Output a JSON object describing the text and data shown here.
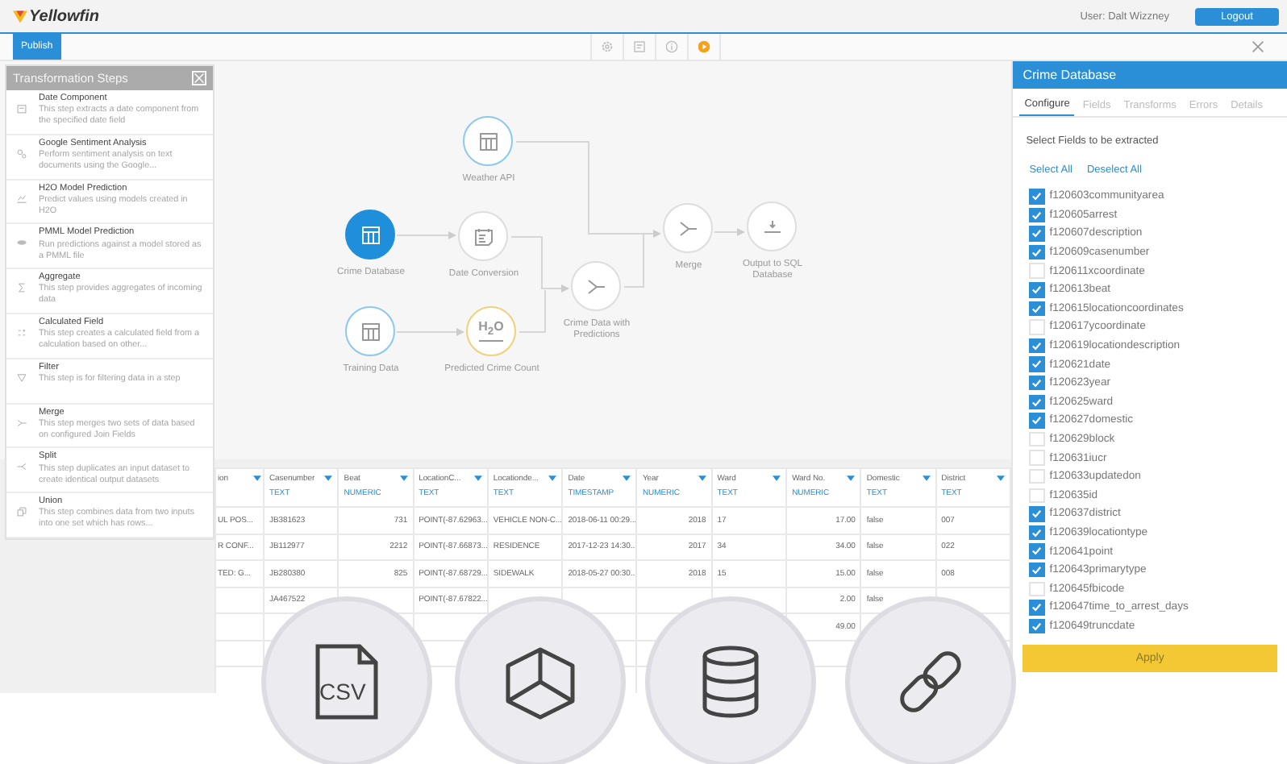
{
  "header": {
    "logo": "Yellowfin",
    "user": "User: Dalt Wizzney",
    "logout": "Logout"
  },
  "toolbar": {
    "tabs": [
      {
        "label": "Publish",
        "selected": true
      }
    ],
    "tools": [
      {
        "kind": "gear"
      },
      {
        "kind": "form"
      },
      {
        "kind": "info"
      },
      {
        "kind": "play"
      }
    ]
  },
  "steps_panel": {
    "title": "Transformation Steps",
    "items": [
      {
        "kind": "date",
        "title": "Date Component",
        "description": "This step extracts a date component from the specified date field"
      },
      {
        "kind": "sentiment",
        "title": "Google Sentiment Analysis",
        "description": "Perform sentiment analysis on text documents using the Google..."
      },
      {
        "kind": "model",
        "title": "H2O Model Prediction",
        "description": "Predict values using models created in H2O"
      },
      {
        "kind": "pmml",
        "title": "PMML Model Prediction",
        "description": "Run predictions against a model stored as a PMML file"
      },
      {
        "kind": "sum",
        "title": "Aggregate",
        "description": "This step provides aggregates of incoming data"
      },
      {
        "kind": "calc",
        "title": "Calculated Field",
        "description": "This step creates a calculated field from a calculation based on other..."
      },
      {
        "kind": "filter",
        "title": "Filter",
        "description": "This step is for filtering data in a step"
      },
      {
        "kind": "merge",
        "title": "Merge",
        "description": "This step merges two sets of data based on configured Join Fields"
      },
      {
        "kind": "split",
        "title": "Split",
        "description": "This step duplicates an input dataset to create identical output datasets"
      },
      {
        "kind": "union",
        "title": "Union",
        "description": "This step combines data from two inputs into one set which has rows..."
      }
    ]
  },
  "diagram": {
    "nodes": [
      {
        "kind": "table",
        "label": "Weather API",
        "color": "#8cc8ee",
        "selected": false
      },
      {
        "kind": "table",
        "label": "Crime Database",
        "color": "#1f8fdc",
        "selected": true
      },
      {
        "kind": "calendar",
        "label": "Date Conversion",
        "color": "#dddddd",
        "selected": false
      },
      {
        "kind": "table",
        "label": "Training Data",
        "color": "#8cc8ee",
        "selected": false
      },
      {
        "kind": "h2o",
        "icon_text": "H$_{2}$O",
        "label": "Predicted Crime Count",
        "color": "#f2cf7a",
        "selected": false
      },
      {
        "kind": "merge",
        "label": "Crime Data with Predictions",
        "color": "#dddddd",
        "selected": false
      },
      {
        "kind": "merge",
        "label": "Merge",
        "color": "#dddddd",
        "selected": false
      },
      {
        "kind": "output",
        "label": "Output to SQL Database",
        "color": "#dddddd",
        "selected": false
      }
    ]
  },
  "table": {
    "columns": [
      {
        "name": "ion"
      },
      {
        "name": "Casenumber",
        "type": "TEXT"
      },
      {
        "name": "Beat",
        "type": "NUMERIC"
      },
      {
        "name": "LocationC...",
        "type": "TEXT"
      },
      {
        "name": "Locationde...",
        "type": "TEXT"
      },
      {
        "name": "Date",
        "type": "TIMESTAMP"
      },
      {
        "name": "Year",
        "type": "NUMERIC"
      },
      {
        "name": "Ward",
        "type": "TEXT"
      },
      {
        "name": "Ward No.",
        "type": "NUMERIC"
      },
      {
        "name": "Domestic",
        "type": "TEXT"
      },
      {
        "name": "District",
        "type": "TEXT"
      }
    ],
    "rows": [
      [
        "UL POS...",
        "JB381623",
        "731",
        "POINT(-87.62963...",
        "VEHICLE NON-C...",
        "2018-06-11 00:29...",
        "2018",
        "17",
        "17.00",
        "false",
        "007"
      ],
      [
        "R CONF...",
        "JB112977",
        "2212",
        "POINT(-87.66873...",
        "RESIDENCE",
        "2017-12-23 14:30...",
        "2017",
        "34",
        "34.00",
        "false",
        "022"
      ],
      [
        "TED: G...",
        "JB280380",
        "825",
        "POINT(-87.68729...",
        "SIDEWALK",
        "2018-05-27 00:30...",
        "2018",
        "15",
        "15.00",
        "false",
        "008"
      ],
      [
        null,
        "JA467522",
        null,
        "POINT(-87.67822...",
        null,
        null,
        null,
        null,
        "2.00",
        "false",
        null
      ],
      [
        null,
        null,
        null,
        null,
        null,
        null,
        null,
        null,
        "49.00",
        null,
        null
      ],
      [
        null,
        null,
        null,
        null,
        null,
        null,
        null,
        null,
        null,
        null,
        null
      ],
      [
        null,
        null,
        null,
        null,
        null,
        null,
        null,
        null,
        null,
        null,
        null
      ]
    ]
  },
  "fields_panel": {
    "title": "Crime Database",
    "tabs": [
      {
        "label": "Configure",
        "selected": true
      },
      {
        "label": "Fields",
        "selected": false
      },
      {
        "label": "Transforms",
        "selected": false
      },
      {
        "label": "Errors",
        "selected": false
      },
      {
        "label": "Details",
        "selected": false
      }
    ],
    "instruction": "Select Fields to be extracted",
    "select_all": "Select All",
    "deselect_all": "Deselect All",
    "fields": [
      {
        "name": "f120603communityarea",
        "checked": true
      },
      {
        "name": "f120605arrest",
        "checked": true
      },
      {
        "name": "f120607description",
        "checked": true
      },
      {
        "name": "f120609casenumber",
        "checked": true
      },
      {
        "name": "f120611xcoordinate",
        "checked": false
      },
      {
        "name": "f120613beat",
        "checked": true
      },
      {
        "name": "f120615locationcoordinates",
        "checked": true
      },
      {
        "name": "f120617ycoordinate",
        "checked": false
      },
      {
        "name": "f120619locationdescription",
        "checked": true
      },
      {
        "name": "f120621date",
        "checked": true
      },
      {
        "name": "f120623year",
        "checked": true
      },
      {
        "name": "f120625ward",
        "checked": true
      },
      {
        "name": "f120627domestic",
        "checked": true
      },
      {
        "name": "f120629block",
        "checked": false
      },
      {
        "name": "f120631iucr",
        "checked": false
      },
      {
        "name": "f120633updatedon",
        "checked": false
      },
      {
        "name": "f120635id",
        "checked": false
      },
      {
        "name": "f120637district",
        "checked": true
      },
      {
        "name": "f120639locationtype",
        "checked": true
      },
      {
        "name": "f120641point",
        "checked": true
      },
      {
        "name": "f120643primarytype",
        "checked": true
      },
      {
        "name": "f120645fbicode",
        "checked": false
      },
      {
        "name": "f120647time_to_arrest_days",
        "checked": true
      },
      {
        "name": "f120649truncdate",
        "checked": true
      }
    ],
    "apply": "Apply"
  },
  "tiles": [
    {
      "kind": "csv",
      "label": "CSV"
    },
    {
      "kind": "cube"
    },
    {
      "kind": "database"
    },
    {
      "kind": "link"
    }
  ]
}
